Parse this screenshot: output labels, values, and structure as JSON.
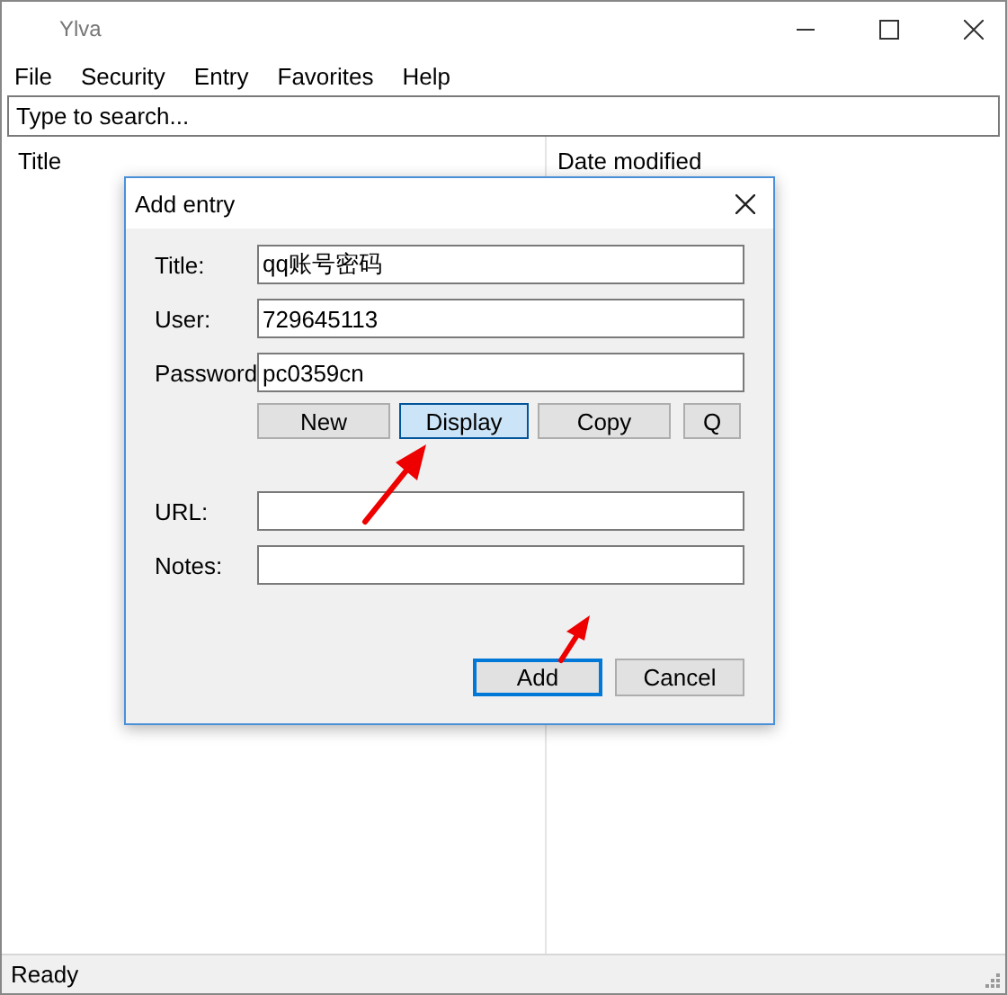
{
  "window": {
    "title": "Ylva"
  },
  "menu": [
    {
      "label": "File"
    },
    {
      "label": "Security"
    },
    {
      "label": "Entry"
    },
    {
      "label": "Favorites"
    },
    {
      "label": "Help"
    }
  ],
  "search": {
    "placeholder": "Type to search..."
  },
  "table": {
    "columns": [
      "Title",
      "Date modified"
    ]
  },
  "status_bar": "Ready",
  "dialog": {
    "title": "Add entry",
    "fields_top": [
      {
        "label": "Title:",
        "value": "qq账号密码"
      },
      {
        "label": "User:",
        "value": "729645113"
      },
      {
        "label": "Password",
        "value": "pc0359cn"
      }
    ],
    "password_buttons": [
      {
        "label": "New",
        "highlighted": false
      },
      {
        "label": "Display",
        "highlighted": true
      },
      {
        "label": "Copy",
        "highlighted": false
      },
      {
        "label": "Q",
        "highlighted": false
      }
    ],
    "fields_bottom": [
      {
        "label": "URL:"
      },
      {
        "label": "Notes:"
      }
    ],
    "actions": [
      {
        "label": "Add",
        "default": true
      },
      {
        "label": "Cancel",
        "default": false
      }
    ]
  }
}
